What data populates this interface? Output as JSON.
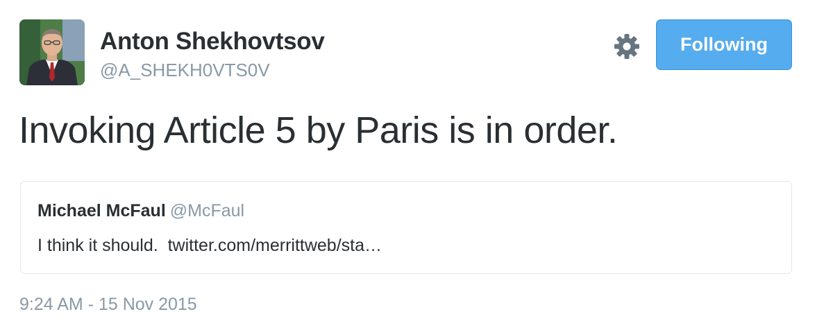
{
  "author": {
    "name": "Anton Shekhovtsov",
    "handle": "@A_SHEKH0VTS0V",
    "avatar_icon": "person-avatar"
  },
  "actions": {
    "settings_icon": "gear-icon",
    "follow_label": "Following"
  },
  "tweet": {
    "text": "Invoking Article 5 by Paris is in order.",
    "timestamp": "9:24 AM - 15 Nov 2015"
  },
  "quoted_tweet": {
    "name": "Michael McFaul",
    "handle": "@McFaul",
    "text": "I think it should.  twitter.com/merrittweb/sta…"
  },
  "colors": {
    "follow_button": "#55acee",
    "secondary_text": "#8899a6",
    "primary_text": "#292f33",
    "border": "#e1e8ed"
  }
}
